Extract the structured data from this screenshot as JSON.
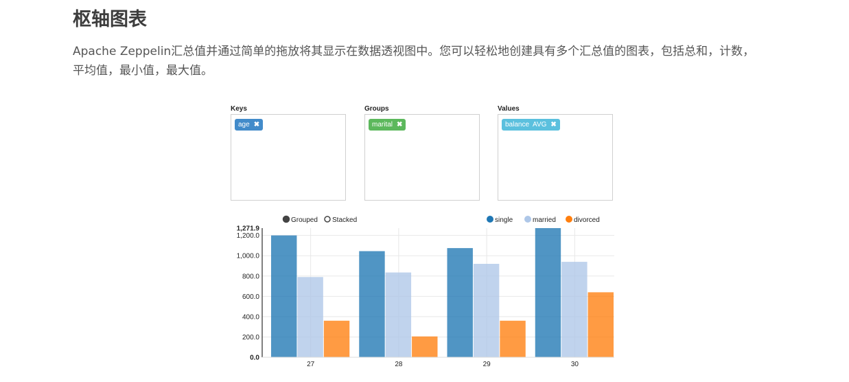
{
  "page": {
    "title": "枢轴图表",
    "intro": "Apache Zeppelin汇总值并通过简单的拖放将其显示在数据透视图中。您可以轻松地创建具有多个汇总值的图表，包括总和，计数，平均值，最小值，最大值。"
  },
  "pivot": {
    "keys": {
      "label": "Keys",
      "pill": "age",
      "color": "#428bca"
    },
    "groups": {
      "label": "Groups",
      "pill": "marital",
      "color": "#5cb85c"
    },
    "values": {
      "label": "Values",
      "pill": "balance  AVG",
      "color": "#5bc0de"
    },
    "remove_glyph": "✖"
  },
  "controls": {
    "grouped_label": "Grouped",
    "stacked_label": "Stacked",
    "selected": "grouped"
  },
  "chart_data": {
    "type": "bar",
    "categories": [
      "27",
      "28",
      "29",
      "30"
    ],
    "series": [
      {
        "name": "single",
        "color": "#1f77b4",
        "values": [
          1200,
          1045,
          1075,
          1271.9
        ]
      },
      {
        "name": "married",
        "color": "#aec7e8",
        "values": [
          790,
          835,
          920,
          940
        ]
      },
      {
        "name": "divorced",
        "color": "#ff7f0e",
        "values": [
          360,
          205,
          360,
          640
        ]
      }
    ],
    "ylim": [
      0,
      1271.9
    ],
    "yticks": [
      "0.0",
      "200.0",
      "400.0",
      "600.0",
      "800.0",
      "1,000.0",
      "1,200.0"
    ],
    "ytick_values": [
      0,
      200,
      400,
      600,
      800,
      1000,
      1200
    ],
    "ymax_label": "1,271.9",
    "legend_position": "top-right",
    "grid": true
  }
}
